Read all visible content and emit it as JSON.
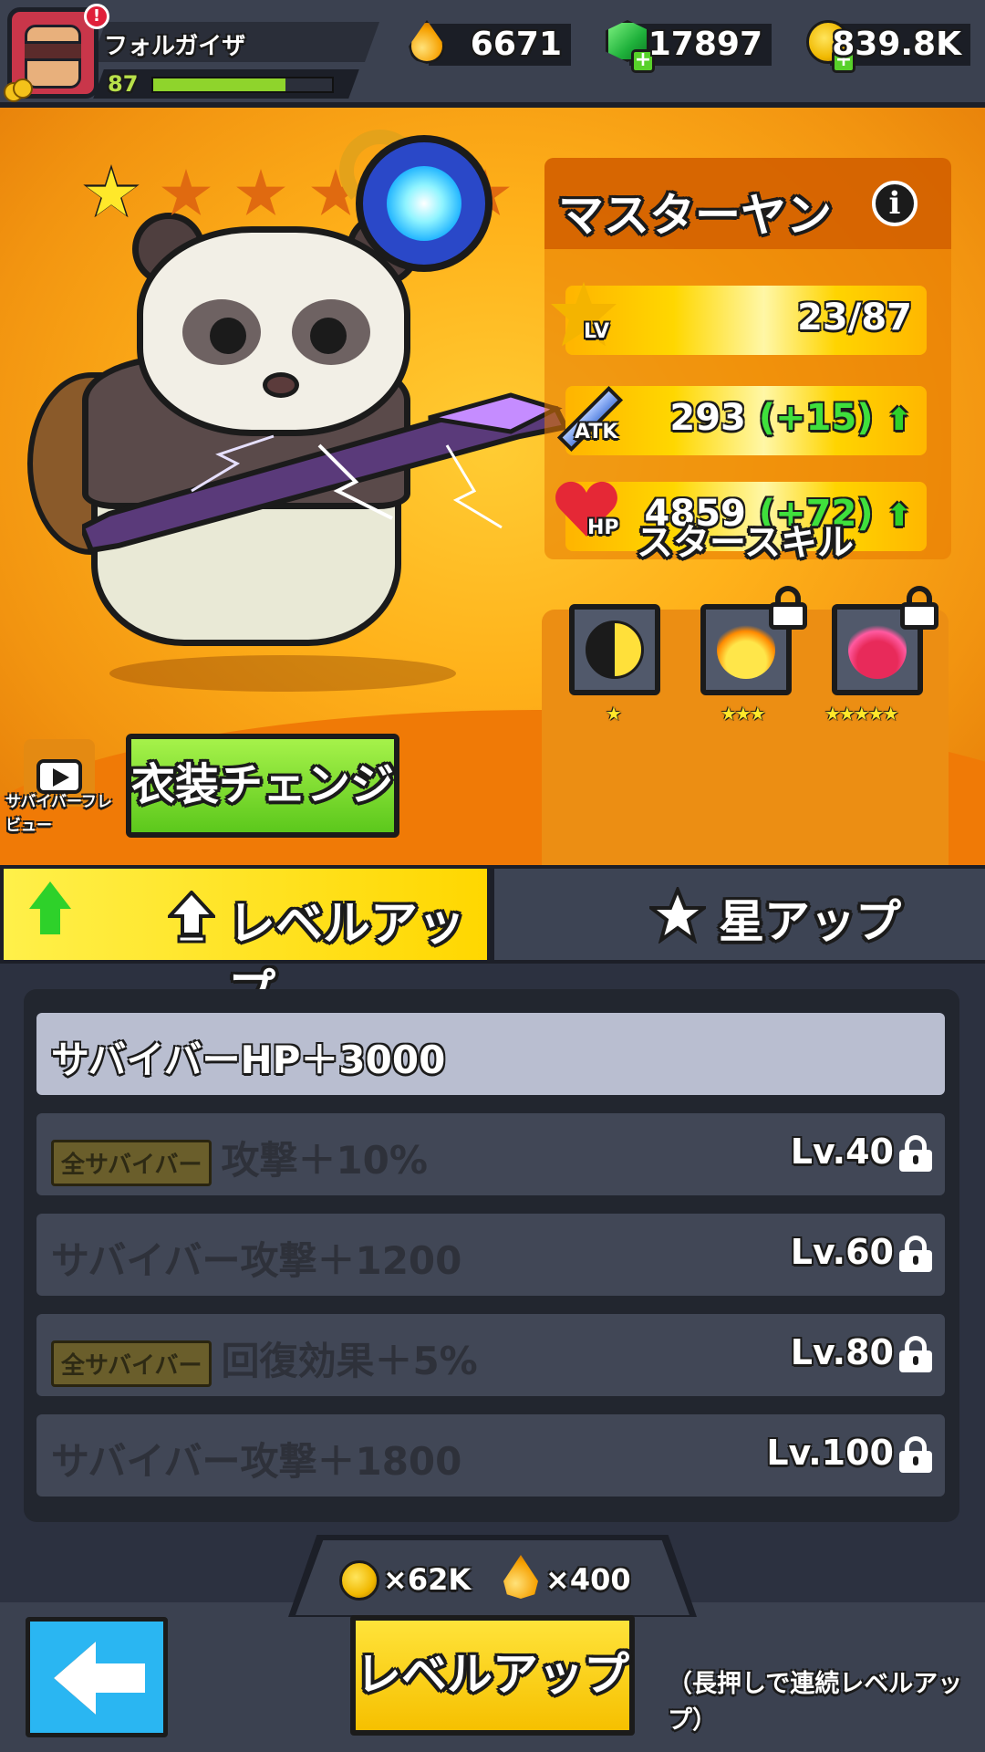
{
  "player": {
    "name": "フォルガイザ",
    "level": "87",
    "xp_fraction": 0.74,
    "alert": "!"
  },
  "resources": {
    "oil": "6671",
    "gems": "17897",
    "coins": "839.8K",
    "plus": "+"
  },
  "hero": {
    "name": "マスターヤン",
    "info_icon": "i",
    "stars_filled": 1,
    "stars_total": 6,
    "stats": {
      "lv": {
        "icon_label": "LV",
        "value": "23/87"
      },
      "atk": {
        "icon_label": "ATK",
        "value": "293",
        "bonus": "(+15)"
      },
      "hp": {
        "icon_label": "HP",
        "value": "4859",
        "bonus": "(+72)"
      }
    }
  },
  "star_skill": {
    "title": "スタースキル",
    "skills": [
      {
        "icon": "yin-yang-icon",
        "stars": "★",
        "locked": false
      },
      {
        "icon": "fire-chick-icon",
        "stars": "★★★",
        "locked": true
      },
      {
        "icon": "fire-demon-icon",
        "stars": "★★★★★",
        "locked": true
      }
    ]
  },
  "review": {
    "label": "サバイバーフレビュー"
  },
  "costume_button": "衣装チェンジ",
  "tabs": {
    "level_up": "レベルアップ",
    "star_up": "星アップ"
  },
  "perks": [
    {
      "tag": "",
      "text": "サバイバーHP＋3000",
      "level": "",
      "locked": false
    },
    {
      "tag": "全サバイバー",
      "text": "攻撃＋10%",
      "level": "Lv.40",
      "locked": true
    },
    {
      "tag": "",
      "text": "サバイバー攻撃＋1200",
      "level": "Lv.60",
      "locked": true
    },
    {
      "tag": "全サバイバー",
      "text": "回復効果＋5%",
      "level": "Lv.80",
      "locked": true
    },
    {
      "tag": "",
      "text": "サバイバー攻撃＋1800",
      "level": "Lv.100",
      "locked": true
    }
  ],
  "cost": {
    "coins": "×62K",
    "oil": "×400"
  },
  "bottom": {
    "levelup_button": "レベルアップ",
    "hold_hint": "（長押しで連続レベルアップ）"
  },
  "colors": {
    "accent_yellow": "#ffd700",
    "active_green": "#2ed12a",
    "panel_dark": "#22262f",
    "back_blue": "#2ab6f2"
  }
}
